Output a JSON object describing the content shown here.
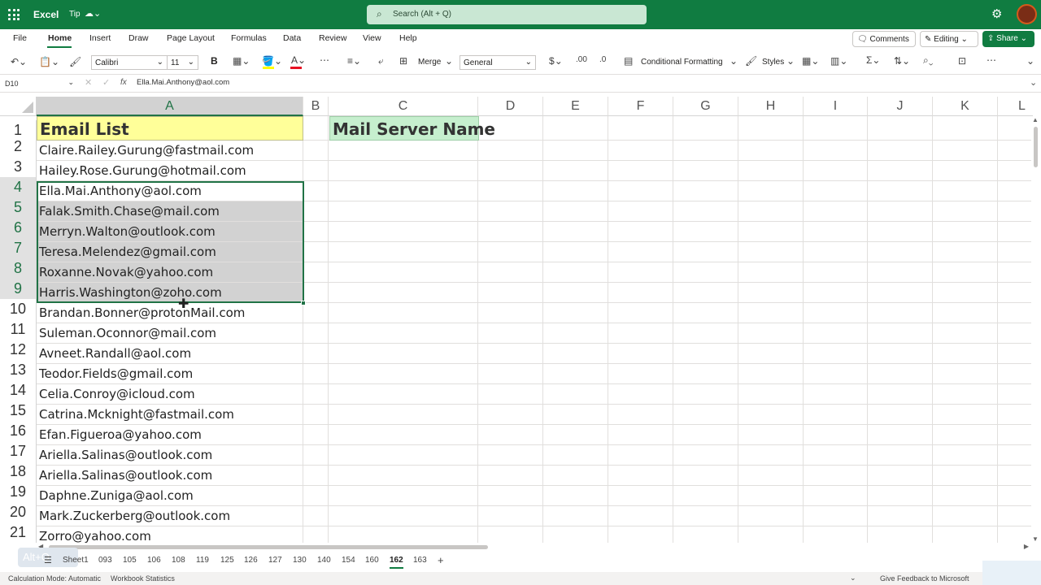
{
  "title_bar": {
    "app_name": "Excel",
    "tip_label": "Tip",
    "search_placeholder": "Search (Alt + Q)"
  },
  "menu": {
    "items": [
      "File",
      "Home",
      "Insert",
      "Draw",
      "Page Layout",
      "Formulas",
      "Data",
      "Review",
      "View",
      "Help"
    ],
    "active": "Home",
    "comments_label": "Comments",
    "editing_label": "Editing",
    "share_label": "Share"
  },
  "ribbon": {
    "font_name": "Calibri",
    "font_size": "11",
    "bold_label": "B",
    "merge_label": "Merge",
    "number_format": "General",
    "conditional_formatting_label": "Conditional Formatting",
    "styles_label": "Styles",
    "currency_symbol": "$"
  },
  "formula_bar": {
    "name_box": "D10",
    "fx_label": "fx",
    "formula": "Ella.Mai.Anthony@aol.com"
  },
  "sheet": {
    "columns": [
      "A",
      "B",
      "C",
      "D",
      "E",
      "F",
      "G",
      "H",
      "I",
      "J",
      "K",
      "L"
    ],
    "header_a1": "Email List",
    "header_c1": "Mail Server Name",
    "rows": [
      "1",
      "2",
      "3",
      "4",
      "5",
      "6",
      "7",
      "8",
      "9",
      "10",
      "11",
      "12",
      "13",
      "14",
      "15",
      "16",
      "17",
      "18",
      "19",
      "20",
      "21"
    ],
    "emails": [
      "Claire.Railey.Gurung@fastmail.com",
      "Hailey.Rose.Gurung@hotmail.com",
      "Ella.Mai.Anthony@aol.com",
      "Falak.Smith.Chase@mail.com",
      "Merryn.Walton@outlook.com",
      "Teresa.Melendez@gmail.com",
      "Roxanne.Novak@yahoo.com",
      "Harris.Washington@zoho.com",
      "Brandan.Bonner@protonMail.com",
      "Suleman.Oconnor@mail.com",
      "Avneet.Randall@aol.com",
      "Teodor.Fields@gmail.com",
      "Celia.Conroy@icloud.com",
      "Catrina.Mcknight@fastmail.com",
      "Efan.Figueroa@yahoo.com",
      "Ariella.Salinas@outlook.com",
      "Ariella.Salinas@outlook.com",
      "Daphne.Zuniga@aol.com",
      "Mark.Zuckerberg@outlook.com",
      "Zorro@yahoo.com"
    ],
    "selected_range": "A4:A9",
    "colors": {
      "a1_fill": "#ffff99",
      "c1_fill": "#c6efce",
      "selection_border": "#217346",
      "selection_fill": "#d2d2d2"
    }
  },
  "sheet_tabs": {
    "tabs": [
      "Sheet1",
      "093",
      "105",
      "106",
      "108",
      "119",
      "125",
      "126",
      "127",
      "130",
      "140",
      "154",
      "160",
      "162",
      "163"
    ],
    "active": "162",
    "alt_hint": "Alt+Q"
  },
  "status_bar": {
    "calc_mode": "Calculation Mode: Automatic",
    "workbook_stats": "Workbook Statistics",
    "feedback": "Give Feedback to Microsoft"
  }
}
